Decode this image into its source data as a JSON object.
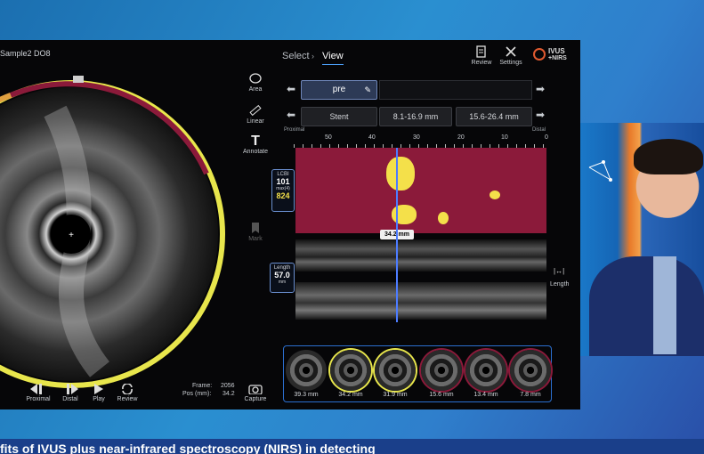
{
  "app": {
    "file_label": "Sample2  DO8",
    "nav_select": "Select",
    "nav_view": "View",
    "review_label": "Review",
    "settings_label": "Settings",
    "logo_top": "IVUS",
    "logo_bottom": "+NIRS"
  },
  "tools": {
    "area": "Area",
    "linear": "Linear",
    "annotate": "Annotate",
    "mark": "Mark"
  },
  "selectors": {
    "pullback": "pre",
    "segment_type": "Stent",
    "range1": "8.1-16.9 mm",
    "range2": "15.6-26.4 mm"
  },
  "axis": {
    "proximal": "Proximal",
    "distal": "Distal",
    "ticks": [
      "50",
      "40",
      "30",
      "20",
      "10",
      "0"
    ]
  },
  "lcbi": {
    "title": "LCBI",
    "value": "101",
    "sub": "max(4)",
    "max_value": "824"
  },
  "length": {
    "title": "Length",
    "value": "57.0",
    "unit": "mm",
    "right_label": "Length"
  },
  "cursor_label": "34.2 mm",
  "thumbnails": [
    "39.3 mm",
    "34.2 mm",
    "31.9 mm",
    "15.6 mm",
    "13.4 mm",
    "7.8 mm"
  ],
  "controls": {
    "proximal": "Proximal",
    "distal": "Distal",
    "play": "Play",
    "review": "Review",
    "capture": "Capture"
  },
  "frame_info": {
    "frame_label": "Frame:",
    "frame_value": "2056",
    "pos_label": "Pos (mm):",
    "pos_value": "34.2"
  },
  "caption": "fits of IVUS plus near-infrared spectroscopy (NIRS) in detecting",
  "colors": {
    "background_blue": "#1b6fb0",
    "chemogram_red": "#8b1a3a",
    "lipid_yellow": "#f4e04a",
    "accent_blue": "#4da3ff"
  }
}
